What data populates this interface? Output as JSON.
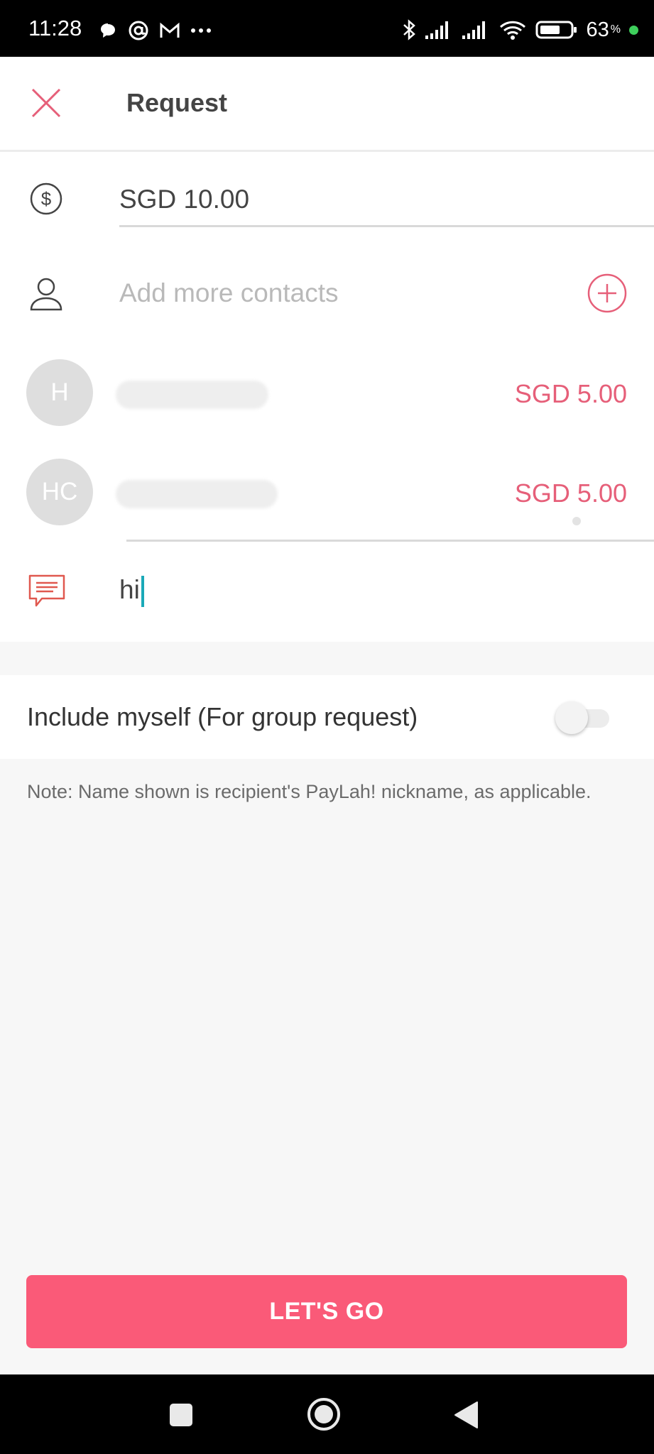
{
  "status_bar": {
    "time": "11:28",
    "battery_text": "63",
    "battery_unit": "%",
    "icons": [
      "chat-bubble-icon",
      "at-icon",
      "gmail-icon",
      "more-dots-icon",
      "bluetooth-icon",
      "signal-icon",
      "signal-icon",
      "wifi-icon",
      "battery-icon",
      "green-dot-icon"
    ]
  },
  "header": {
    "title": "Request",
    "close_icon": "close-icon"
  },
  "form": {
    "amount_value": "SGD  10.00",
    "contacts_placeholder": "Add more contacts",
    "contacts": [
      {
        "initials": "H",
        "amount": "SGD 5.00"
      },
      {
        "initials": "HC",
        "amount": "SGD 5.00"
      }
    ],
    "message_value": "hi"
  },
  "toggle": {
    "label": "Include myself (For group request)",
    "checked": false
  },
  "note": "Note: Name shown is recipient's PayLah! nickname, as applicable.",
  "cta": {
    "label": "LET'S GO"
  },
  "colors": {
    "accent": "#fa5a78",
    "amount_pink": "#e65f79",
    "caret": "#1aa9b8"
  }
}
